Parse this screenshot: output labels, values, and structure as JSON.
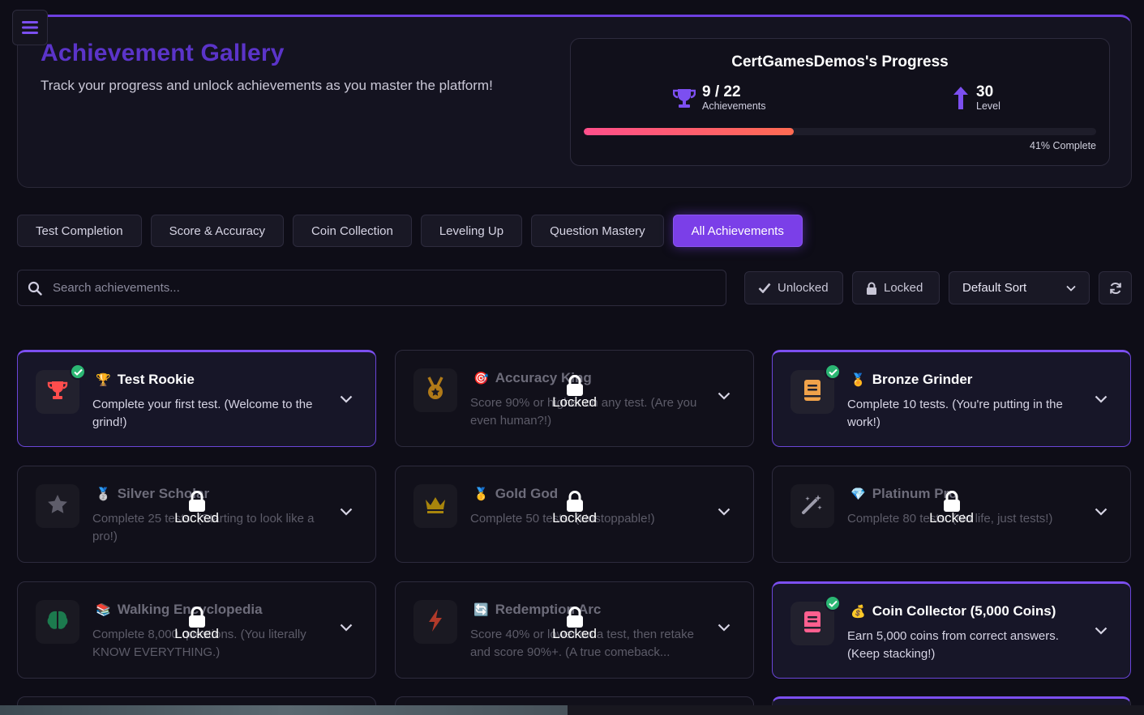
{
  "hero": {
    "title": "Achievement Gallery",
    "subtitle": "Track your progress and unlock achievements as you master the platform!"
  },
  "progress": {
    "title": "CertGamesDemos's Progress",
    "achievements_value": "9 / 22",
    "achievements_label": "Achievements",
    "level_value": "30",
    "level_label": "Level",
    "percent": 41,
    "percent_text": "41% Complete"
  },
  "tabs": [
    {
      "label": "Test Completion",
      "active": false
    },
    {
      "label": "Score & Accuracy",
      "active": false
    },
    {
      "label": "Coin Collection",
      "active": false
    },
    {
      "label": "Leveling Up",
      "active": false
    },
    {
      "label": "Question Mastery",
      "active": false
    },
    {
      "label": "All Achievements",
      "active": true
    }
  ],
  "search": {
    "placeholder": "Search achievements..."
  },
  "filters": {
    "unlocked": "Unlocked",
    "locked": "Locked",
    "sort": "Default Sort"
  },
  "lock_label": "Locked",
  "cards": [
    {
      "emoji": "🏆",
      "title": "Test Rookie",
      "desc": "Complete your first test. (Welcome to the grind!)",
      "unlocked": true,
      "icon": "trophy-icon",
      "color": "#ff4d4d"
    },
    {
      "emoji": "🎯",
      "title": "Accuracy King",
      "desc": "Score 90% or higher on any test. (Are you even human?!)",
      "unlocked": false,
      "icon": "medal-icon",
      "color": "#b07a18"
    },
    {
      "emoji": "🏅",
      "title": "Bronze Grinder",
      "desc": "Complete 10 tests. (You're putting in the work!)",
      "unlocked": true,
      "icon": "book-icon",
      "color": "#f0a24a"
    },
    {
      "emoji": "🥈",
      "title": "Silver Scholar",
      "desc": "Complete 25 tests. (Starting to look like a pro!)",
      "unlocked": false,
      "icon": "star-icon",
      "color": "#5e5d6a"
    },
    {
      "emoji": "🥇",
      "title": "Gold God",
      "desc": "Complete 50 tests. (Unstoppable!)",
      "unlocked": false,
      "icon": "crown-icon",
      "color": "#a8850c"
    },
    {
      "emoji": "💎",
      "title": "Platinum Pro",
      "desc": "Complete 80 tests. (No life, just tests!)",
      "unlocked": false,
      "icon": "magic-wand-icon",
      "color": "#9d9cab"
    },
    {
      "emoji": "📚",
      "title": "Walking Encyclopedia",
      "desc": "Complete 8,000 questions. (You literally KNOW EVERYTHING.)",
      "unlocked": false,
      "icon": "brain-icon",
      "color": "#1c7a4e"
    },
    {
      "emoji": "🔄",
      "title": "Redemption Arc",
      "desc": "Score 40% or lower on a test, then retake and score 90%+. (A true comeback...",
      "unlocked": false,
      "icon": "bolt-icon",
      "color": "#b13a2a"
    },
    {
      "emoji": "💰",
      "title": "Coin Collector (5,000 Coins)",
      "desc": "Earn 5,000 coins from correct answers. (Keep stacking!)",
      "unlocked": true,
      "icon": "book-icon",
      "color": "#ff5f8f"
    }
  ]
}
